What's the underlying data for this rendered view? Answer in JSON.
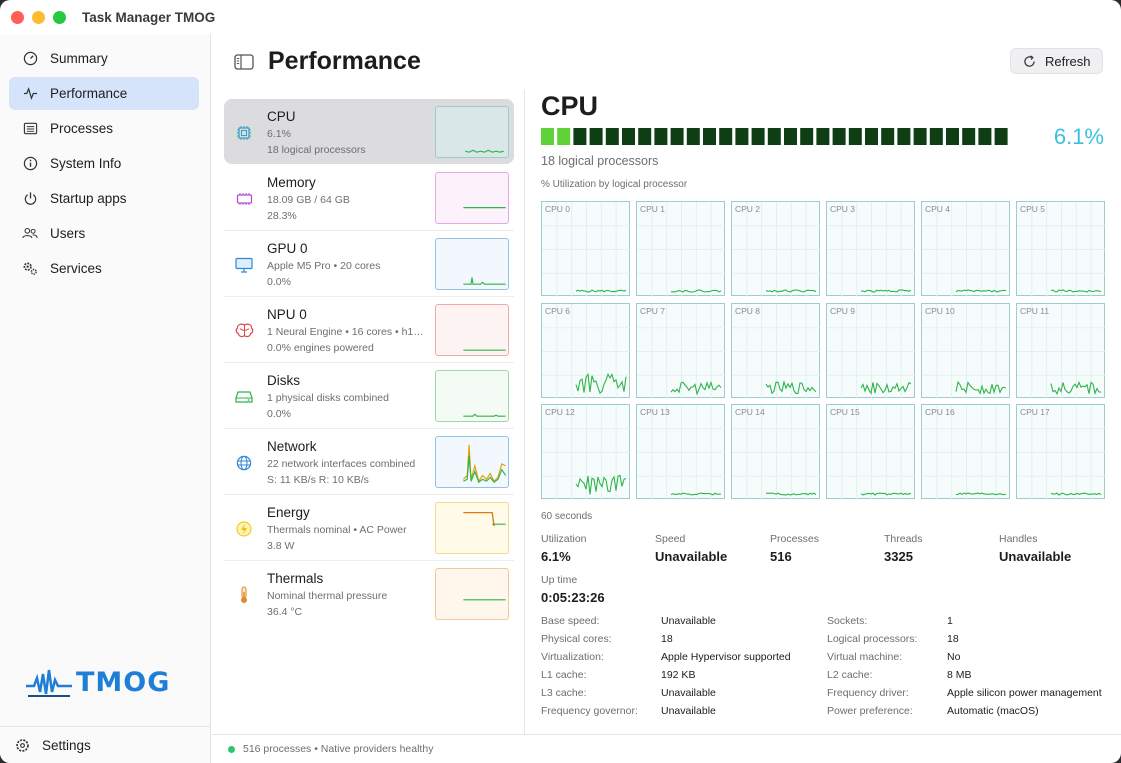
{
  "window": {
    "title": "Task Manager TMOG"
  },
  "sidebar": {
    "items": [
      {
        "label": "Summary",
        "icon": "gauge-icon"
      },
      {
        "label": "Performance",
        "icon": "pulse-icon",
        "active": true
      },
      {
        "label": "Processes",
        "icon": "list-icon"
      },
      {
        "label": "System Info",
        "icon": "info-icon"
      },
      {
        "label": "Startup apps",
        "icon": "power-icon"
      },
      {
        "label": "Users",
        "icon": "users-icon"
      },
      {
        "label": "Services",
        "icon": "gears-icon"
      }
    ],
    "logo_text": "TMOG",
    "settings_label": "Settings"
  },
  "header": {
    "title": "Performance",
    "refresh_label": "Refresh"
  },
  "resources": [
    {
      "name": "CPU",
      "line1": "6.1%",
      "line2": "18 logical processors",
      "color": "#2fb44a",
      "icon": "cpu-icon"
    },
    {
      "name": "Memory",
      "line1": "18.09 GB / 64 GB",
      "line2": "28.3%",
      "color": "#b04ad6",
      "icon": "memory-icon"
    },
    {
      "name": "GPU 0",
      "line1": "Apple M5 Pro • 20 cores",
      "line2": "0.0%",
      "color": "#2f86d6",
      "icon": "monitor-icon"
    },
    {
      "name": "NPU 0",
      "line1": "1 Neural Engine • 16 cores • h1…",
      "line2": "0.0% engines powered",
      "color": "#e0484e",
      "icon": "brain-icon"
    },
    {
      "name": "Disks",
      "line1": "1 physical disks combined",
      "line2": "0.0%",
      "color": "#2fb44a",
      "icon": "disk-icon"
    },
    {
      "name": "Network",
      "line1": "22 network interfaces combined",
      "line2": "S: 11 KB/s  R: 10 KB/s",
      "color": "#2f86d6",
      "icon": "globe-icon"
    },
    {
      "name": "Energy",
      "line1": "Thermals nominal • AC Power",
      "line2": "3.8 W",
      "color": "#f2c200",
      "icon": "bolt-icon"
    },
    {
      "name": "Thermals",
      "line1": "Nominal thermal pressure",
      "line2": "36.4 °C",
      "color": "#e08a2c",
      "icon": "thermometer-icon"
    }
  ],
  "detail": {
    "title": "CPU",
    "utilization": "6.1%",
    "utilization_fraction": 0.061,
    "logical_processors": "18 logical processors",
    "grid_label": "% Utilization by logical processor",
    "cores": [
      "CPU 0",
      "CPU 1",
      "CPU 2",
      "CPU 3",
      "CPU 4",
      "CPU 5",
      "CPU 6",
      "CPU 7",
      "CPU 8",
      "CPU 9",
      "CPU 10",
      "CPU 11",
      "CPU 12",
      "CPU 13",
      "CPU 14",
      "CPU 15",
      "CPU 16",
      "CPU 17"
    ],
    "window_label": "60 seconds",
    "stats": [
      {
        "label": "Utilization",
        "value": "6.1%"
      },
      {
        "label": "Speed",
        "value": "Unavailable"
      },
      {
        "label": "Processes",
        "value": "516"
      },
      {
        "label": "Threads",
        "value": "3325"
      },
      {
        "label": "Handles",
        "value": "Unavailable"
      }
    ],
    "uptime": {
      "label": "Up time",
      "value": "0:05:23:26"
    },
    "info_left": [
      {
        "k": "Base speed:",
        "v": "Unavailable"
      },
      {
        "k": "Physical cores:",
        "v": "18"
      },
      {
        "k": "Virtualization:",
        "v": "Apple Hypervisor supported"
      },
      {
        "k": "L1 cache:",
        "v": "192 KB"
      },
      {
        "k": "L3 cache:",
        "v": "Unavailable"
      },
      {
        "k": "Frequency governor:",
        "v": "Unavailable"
      }
    ],
    "info_right": [
      {
        "k": "Sockets:",
        "v": "1"
      },
      {
        "k": "Logical processors:",
        "v": "18"
      },
      {
        "k": "Virtual machine:",
        "v": "No"
      },
      {
        "k": "L2 cache:",
        "v": "8 MB"
      },
      {
        "k": "Frequency driver:",
        "v": "Apple silicon power management"
      },
      {
        "k": "Power preference:",
        "v": "Automatic (macOS)"
      }
    ]
  },
  "status": {
    "text": "516 processes • Native providers healthy"
  }
}
